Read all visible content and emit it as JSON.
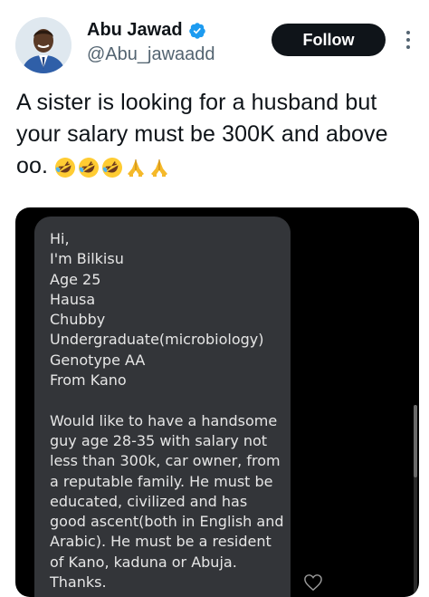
{
  "author": {
    "display_name": "Abu Jawad",
    "handle": "@Abu_jawaadd",
    "verified": true
  },
  "actions": {
    "follow_label": "Follow"
  },
  "tweet": {
    "text": "A sister is looking for a husband but your salary must be 300K and above oo.",
    "emojis": [
      "rolling-on-floor-laughing",
      "rolling-on-floor-laughing",
      "rolling-on-floor-laughing",
      "folded-hands",
      "folded-hands"
    ]
  },
  "media": {
    "message_lines": "Hi,\nI'm Bilkisu\nAge 25\nHausa\nChubby\nUndergraduate(microbiology)\nGenotype AA\nFrom Kano\n\nWould like to have a handsome guy age 28-35 with salary not less than 300k, car owner, from a reputable family. He must be educated, civilized and has good ascent(both in English and Arabic). He must be a resident of Kano, kaduna or Abuja. Thanks."
  },
  "colors": {
    "text_primary": "#0f1419",
    "text_secondary": "#536471",
    "verified_blue": "#1d9bf0",
    "follow_bg": "#0f1419",
    "bubble_bg": "#333539",
    "media_bg": "#000000"
  },
  "icons": [
    "verified-badge-icon",
    "more-options-icon",
    "heart-reaction-icon"
  ]
}
